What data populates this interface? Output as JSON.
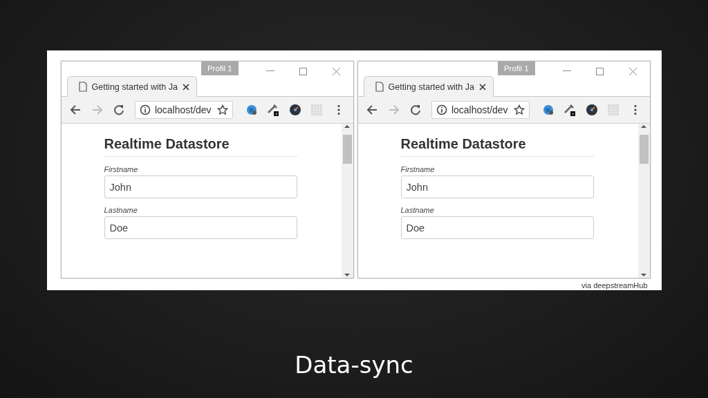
{
  "slide": {
    "title": "Data-sync",
    "credit": "via deepstreamHub"
  },
  "windows": [
    {
      "profile": "Profil 1",
      "tab_title": "Getting started with Ja",
      "address": "localhost/dev",
      "page": {
        "heading": "Realtime Datastore",
        "fields": [
          {
            "label": "Firstname",
            "value": "John"
          },
          {
            "label": "Lastname",
            "value": "Doe"
          }
        ]
      }
    },
    {
      "profile": "Profil 1",
      "tab_title": "Getting started with Ja",
      "address": "localhost/dev",
      "page": {
        "heading": "Realtime Datastore",
        "fields": [
          {
            "label": "Firstname",
            "value": "John"
          },
          {
            "label": "Lastname",
            "value": "Doe"
          }
        ]
      }
    }
  ]
}
